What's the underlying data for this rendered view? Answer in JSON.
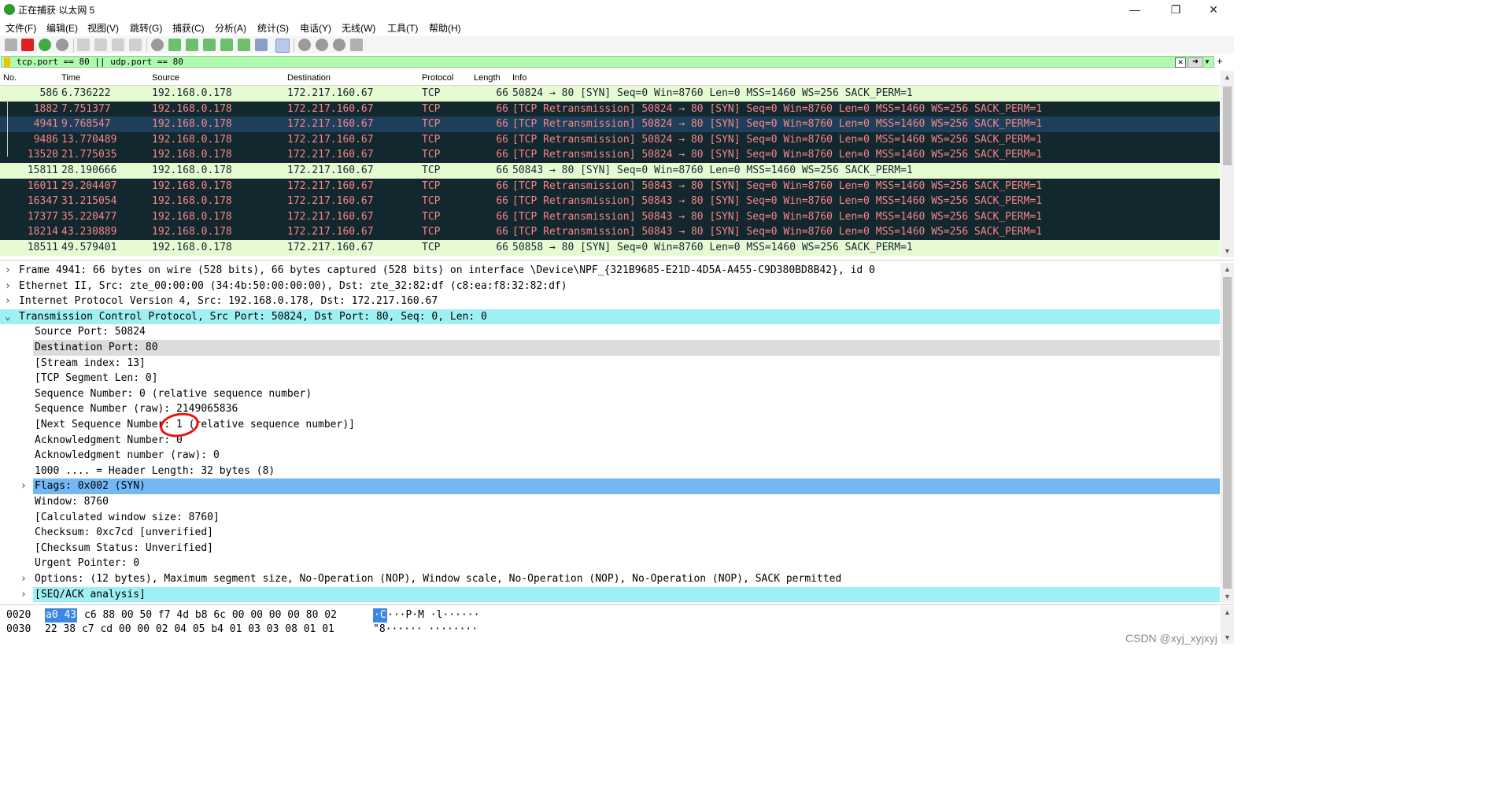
{
  "window": {
    "title": "正在捕获 以太网 5",
    "controls": [
      "—",
      "❐",
      "✕"
    ]
  },
  "menu": [
    "文件(F)",
    "编辑(E)",
    "视图(V)",
    "跳转(G)",
    "捕获(C)",
    "分析(A)",
    "统计(S)",
    "电话(Y)",
    "无线(W)",
    "工具(T)",
    "帮助(H)"
  ],
  "filter": {
    "value": "tcp.port == 80 || udp.port == 80",
    "clear_icon": "x-icon",
    "apply_icon": "arrow-right-icon"
  },
  "packet_list": {
    "columns": [
      "No.",
      "Time",
      "Source",
      "Destination",
      "Protocol",
      "Length",
      "Info"
    ],
    "rows": [
      {
        "no": "586",
        "time": "6.736222",
        "src": "192.168.0.178",
        "dst": "172.217.160.67",
        "proto": "TCP",
        "len": "66",
        "info": "50824 → 80 [SYN] Seq=0 Win=8760 Len=0 MSS=1460 WS=256 SACK_PERM=1",
        "style": "normal"
      },
      {
        "no": "1882",
        "time": "7.751377",
        "src": "192.168.0.178",
        "dst": "172.217.160.67",
        "proto": "TCP",
        "len": "66",
        "info": "[TCP Retransmission] 50824 → 80 [SYN] Seq=0 Win=8760 Len=0 MSS=1460 WS=256 SACK_PERM=1",
        "style": "bad"
      },
      {
        "no": "4941",
        "time": "9.768547",
        "src": "192.168.0.178",
        "dst": "172.217.160.67",
        "proto": "TCP",
        "len": "66",
        "info": "[TCP Retransmission] 50824 → 80 [SYN] Seq=0 Win=8760 Len=0 MSS=1460 WS=256 SACK_PERM=1",
        "style": "sel"
      },
      {
        "no": "9486",
        "time": "13.770489",
        "src": "192.168.0.178",
        "dst": "172.217.160.67",
        "proto": "TCP",
        "len": "66",
        "info": "[TCP Retransmission] 50824 → 80 [SYN] Seq=0 Win=8760 Len=0 MSS=1460 WS=256 SACK_PERM=1",
        "style": "bad"
      },
      {
        "no": "13520",
        "time": "21.775035",
        "src": "192.168.0.178",
        "dst": "172.217.160.67",
        "proto": "TCP",
        "len": "66",
        "info": "[TCP Retransmission] 50824 → 80 [SYN] Seq=0 Win=8760 Len=0 MSS=1460 WS=256 SACK_PERM=1",
        "style": "bad"
      },
      {
        "no": "15811",
        "time": "28.190666",
        "src": "192.168.0.178",
        "dst": "172.217.160.67",
        "proto": "TCP",
        "len": "66",
        "info": "50843 → 80 [SYN] Seq=0 Win=8760 Len=0 MSS=1460 WS=256 SACK_PERM=1",
        "style": "normal"
      },
      {
        "no": "16011",
        "time": "29.204407",
        "src": "192.168.0.178",
        "dst": "172.217.160.67",
        "proto": "TCP",
        "len": "66",
        "info": "[TCP Retransmission] 50843 → 80 [SYN] Seq=0 Win=8760 Len=0 MSS=1460 WS=256 SACK_PERM=1",
        "style": "bad"
      },
      {
        "no": "16347",
        "time": "31.215054",
        "src": "192.168.0.178",
        "dst": "172.217.160.67",
        "proto": "TCP",
        "len": "66",
        "info": "[TCP Retransmission] 50843 → 80 [SYN] Seq=0 Win=8760 Len=0 MSS=1460 WS=256 SACK_PERM=1",
        "style": "bad"
      },
      {
        "no": "17377",
        "time": "35.220477",
        "src": "192.168.0.178",
        "dst": "172.217.160.67",
        "proto": "TCP",
        "len": "66",
        "info": "[TCP Retransmission] 50843 → 80 [SYN] Seq=0 Win=8760 Len=0 MSS=1460 WS=256 SACK_PERM=1",
        "style": "bad"
      },
      {
        "no": "18214",
        "time": "43.230889",
        "src": "192.168.0.178",
        "dst": "172.217.160.67",
        "proto": "TCP",
        "len": "66",
        "info": "[TCP Retransmission] 50843 → 80 [SYN] Seq=0 Win=8760 Len=0 MSS=1460 WS=256 SACK_PERM=1",
        "style": "bad"
      },
      {
        "no": "18511",
        "time": "49.579401",
        "src": "192.168.0.178",
        "dst": "172.217.160.67",
        "proto": "TCP",
        "len": "66",
        "info": "50858 → 80 [SYN] Seq=0 Win=8760 Len=0 MSS=1460 WS=256 SACK_PERM=1",
        "style": "normal"
      }
    ]
  },
  "details": [
    {
      "text": "Frame 4941: 66 bytes on wire (528 bits), 66 bytes captured (528 bits) on interface \\Device\\NPF_{321B9685-E21D-4D5A-A455-C9D380BD8B42}, id 0",
      "level": 0,
      "chev": "›",
      "hl": ""
    },
    {
      "text": "Ethernet II, Src: zte_00:00:00 (34:4b:50:00:00:00), Dst: zte_32:82:df (c8:ea:f8:32:82:df)",
      "level": 0,
      "chev": "›",
      "hl": ""
    },
    {
      "text": "Internet Protocol Version 4, Src: 192.168.0.178, Dst: 172.217.160.67",
      "level": 0,
      "chev": "›",
      "hl": ""
    },
    {
      "text": "Transmission Control Protocol, Src Port: 50824, Dst Port: 80, Seq: 0, Len: 0",
      "level": 0,
      "chev": "⌄",
      "hl": "cyan"
    },
    {
      "text": "Source Port: 50824",
      "level": 1,
      "chev": "",
      "hl": ""
    },
    {
      "text": "Destination Port: 80",
      "level": 1,
      "chev": "",
      "hl": "grey"
    },
    {
      "text": "[Stream index: 13]",
      "level": 1,
      "chev": "",
      "hl": ""
    },
    {
      "text": "[TCP Segment Len: 0]",
      "level": 1,
      "chev": "",
      "hl": ""
    },
    {
      "text": "Sequence Number: 0    (relative sequence number)",
      "level": 1,
      "chev": "",
      "hl": ""
    },
    {
      "text": "Sequence Number (raw): 2149065836",
      "level": 1,
      "chev": "",
      "hl": ""
    },
    {
      "text": "[Next Sequence Number: 1    (relative sequence number)]",
      "level": 1,
      "chev": "",
      "hl": ""
    },
    {
      "text": "Acknowledgment Number: 0",
      "level": 1,
      "chev": "",
      "hl": ""
    },
    {
      "text": "Acknowledgment number (raw): 0",
      "level": 1,
      "chev": "",
      "hl": ""
    },
    {
      "text": "1000 .... = Header Length: 32 bytes (8)",
      "level": 1,
      "chev": "",
      "hl": ""
    },
    {
      "text": "Flags: 0x002 (SYN)",
      "level": 1,
      "chev": "›",
      "hl": "blue"
    },
    {
      "text": "Window: 8760",
      "level": 1,
      "chev": "",
      "hl": ""
    },
    {
      "text": "[Calculated window size: 8760]",
      "level": 1,
      "chev": "",
      "hl": ""
    },
    {
      "text": "Checksum: 0xc7cd [unverified]",
      "level": 1,
      "chev": "",
      "hl": ""
    },
    {
      "text": "[Checksum Status: Unverified]",
      "level": 1,
      "chev": "",
      "hl": ""
    },
    {
      "text": "Urgent Pointer: 0",
      "level": 1,
      "chev": "",
      "hl": ""
    },
    {
      "text": "Options: (12 bytes), Maximum segment size, No-Operation (NOP), Window scale, No-Operation (NOP), No-Operation (NOP), SACK permitted",
      "level": 1,
      "chev": "›",
      "hl": ""
    },
    {
      "text": "[SEQ/ACK analysis]",
      "level": 1,
      "chev": "›",
      "hl": "cyan"
    }
  ],
  "bytes": [
    {
      "offset": "0020",
      "sel": "a0 43",
      "hex": "c6 88 00 50 f7 4d  b8 6c 00 00 00 00 80 02",
      "ascii_sel": "·C",
      "ascii": "···P·M ·l······"
    },
    {
      "offset": "0030",
      "sel": "",
      "hex": "22 38 c7 cd 00 00 02 04  05 b4 01 03 03 08 01 01",
      "ascii_sel": "",
      "ascii": "\"8······ ········"
    }
  ],
  "watermark": "CSDN @xyj_xyjxyj",
  "colors": {
    "normal_bg": "#e7fbd3",
    "bad_bg": "#12272e",
    "bad_fg": "#f78787",
    "selected_bg": "#1e3f5a",
    "filter_bg": "#affaaf"
  }
}
